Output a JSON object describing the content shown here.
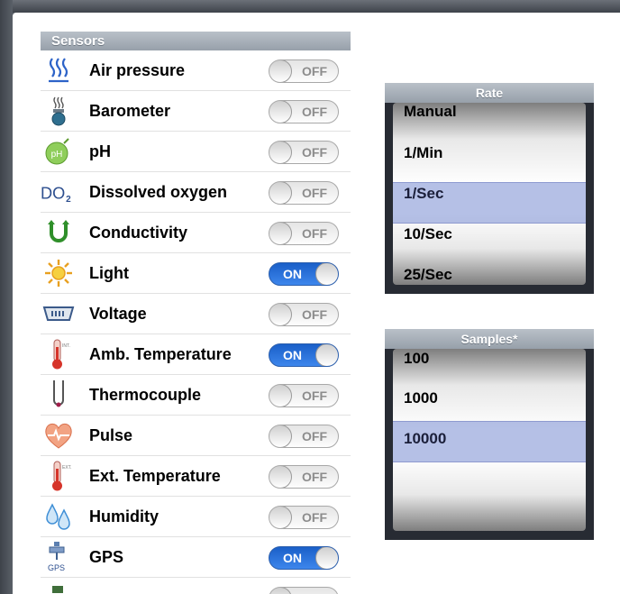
{
  "sensors": {
    "header": "Sensors",
    "items": [
      {
        "label": "Air pressure",
        "state": "OFF",
        "on": false,
        "icon": "air-pressure-icon"
      },
      {
        "label": "Barometer",
        "state": "OFF",
        "on": false,
        "icon": "barometer-icon"
      },
      {
        "label": "pH",
        "state": "OFF",
        "on": false,
        "icon": "ph-icon"
      },
      {
        "label": "Dissolved oxygen",
        "state": "OFF",
        "on": false,
        "icon": "dissolved-oxygen-icon"
      },
      {
        "label": "Conductivity",
        "state": "OFF",
        "on": false,
        "icon": "conductivity-icon"
      },
      {
        "label": "Light",
        "state": "ON",
        "on": true,
        "icon": "light-icon"
      },
      {
        "label": "Voltage",
        "state": "OFF",
        "on": false,
        "icon": "voltage-icon"
      },
      {
        "label": "Amb. Temperature",
        "state": "ON",
        "on": true,
        "icon": "amb-temperature-icon"
      },
      {
        "label": "Thermocouple",
        "state": "OFF",
        "on": false,
        "icon": "thermocouple-icon"
      },
      {
        "label": "Pulse",
        "state": "OFF",
        "on": false,
        "icon": "pulse-icon"
      },
      {
        "label": "Ext. Temperature",
        "state": "OFF",
        "on": false,
        "icon": "ext-temperature-icon"
      },
      {
        "label": "Humidity",
        "state": "OFF",
        "on": false,
        "icon": "humidity-icon"
      },
      {
        "label": "GPS",
        "state": "ON",
        "on": true,
        "icon": "gps-icon"
      }
    ],
    "icon_text": {
      "ph": "pH",
      "do": "DO",
      "do_sub": "2",
      "int": "INT.",
      "ext": "EXT.",
      "gps": "GPS"
    }
  },
  "rate": {
    "title": "Rate",
    "options": [
      "Manual",
      "1/Min",
      "1/Sec",
      "10/Sec",
      "25/Sec"
    ],
    "selected": "1/Sec"
  },
  "samples": {
    "title": "Samples*",
    "options": [
      "100",
      "1000",
      "10000"
    ],
    "selected": "10000"
  },
  "colors": {
    "toggle_on": "#2f7ae0",
    "header": "#a9b1ba",
    "picker_selection": "#8f9fd8"
  }
}
